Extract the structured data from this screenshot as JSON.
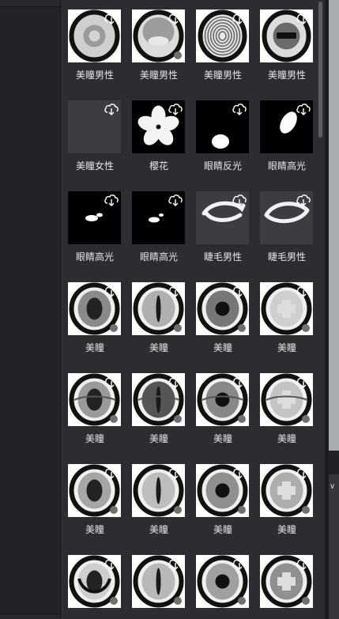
{
  "panel": {
    "items": [
      {
        "label": "美瞳男性",
        "thumb": "eye-ring"
      },
      {
        "label": "美瞳男性",
        "thumb": "eye-soft"
      },
      {
        "label": "美瞳男性",
        "thumb": "eye-rings"
      },
      {
        "label": "美瞳男性",
        "thumb": "eye-bar"
      },
      {
        "label": "美瞳女性",
        "thumb": "grey-square"
      },
      {
        "label": "樱花",
        "thumb": "sakura"
      },
      {
        "label": "眼睛反光",
        "thumb": "highlight-dot"
      },
      {
        "label": "眼睛高光",
        "thumb": "highlight-oval"
      },
      {
        "label": "眼睛高光",
        "thumb": "highlight-pair"
      },
      {
        "label": "眼睛高光",
        "thumb": "highlight-pair-small"
      },
      {
        "label": "睫毛男性",
        "thumb": "lash-a"
      },
      {
        "label": "睫毛男性",
        "thumb": "lash-b"
      },
      {
        "label": "美瞳",
        "thumb": "lens-1"
      },
      {
        "label": "美瞳",
        "thumb": "lens-2"
      },
      {
        "label": "美瞳",
        "thumb": "lens-3"
      },
      {
        "label": "美瞳",
        "thumb": "lens-4"
      },
      {
        "label": "美瞳",
        "thumb": "lens-5"
      },
      {
        "label": "美瞳",
        "thumb": "lens-6"
      },
      {
        "label": "美瞳",
        "thumb": "lens-7"
      },
      {
        "label": "美瞳",
        "thumb": "lens-8"
      },
      {
        "label": "美瞳",
        "thumb": "lens-9"
      },
      {
        "label": "美瞳",
        "thumb": "lens-10"
      },
      {
        "label": "美瞳",
        "thumb": "lens-11"
      },
      {
        "label": "美瞳",
        "thumb": "lens-12"
      },
      {
        "label": "",
        "thumb": "lens-13"
      },
      {
        "label": "",
        "thumb": "lens-14"
      },
      {
        "label": "",
        "thumb": "lens-15"
      },
      {
        "label": "",
        "thumb": "lens-16"
      }
    ],
    "download_icon": "cloud-download-icon"
  },
  "colors": {
    "panel_bg": "#2b2d30",
    "label": "#e6e6e6",
    "scroll_thumb": "#5b5e63"
  }
}
